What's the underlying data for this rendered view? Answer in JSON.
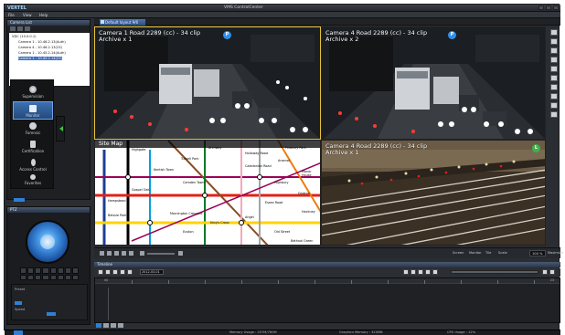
{
  "app": {
    "brand": "VERTEL",
    "title": "VMS ControlCenter"
  },
  "menu": [
    "File",
    "View",
    "Help"
  ],
  "left": {
    "tree_header": "Camera List",
    "tree": [
      "VDC (10.0.0.1)",
      "Camera 1 - 10.46.2.13(Auth)",
      "Camera 4 - 10.46.2.13(23)",
      "Camera 1 - 10.45.2.14(Auth)",
      "Camera 1 - 10.45.2.14(23)"
    ]
  },
  "nav": [
    {
      "label": "Supervision",
      "icon": "globe-icon"
    },
    {
      "label": "Monitor",
      "icon": "camera-icon",
      "active": true
    },
    {
      "label": "Forensic",
      "icon": "magnifier-icon"
    },
    {
      "label": "Certification",
      "icon": "document-icon"
    },
    {
      "label": "Access Control",
      "icon": "person-walking-icon"
    },
    {
      "label": "Favorites",
      "icon": "star-icon"
    }
  ],
  "ptz": {
    "header": "PTZ",
    "presets_label": "Preset",
    "speed_label": "Speed"
  },
  "main": {
    "tab": "Default layout 9/6",
    "tiles": [
      {
        "name": "Camera 1 Road 2289 (cc) - 34 clip",
        "sub": "Archive x 1",
        "badge": "P",
        "badge_color": "#2f8fe8",
        "selected": true
      },
      {
        "name": "Camera 4 Road 2289 (cc) - 34 clip",
        "sub": "Archive x 2",
        "badge": "P",
        "badge_color": "#2f8fe8",
        "selected": false
      },
      {
        "name": "Site Map",
        "sub": "",
        "badge": "",
        "badge_color": "",
        "selected": false
      },
      {
        "name": "Camera 4 Road 2289 (cc) - 34 clip",
        "sub": "Archive x 1",
        "badge": "L",
        "badge_color": "#3bb54a",
        "selected": false
      }
    ],
    "map_labels": [
      "Highgate",
      "Archway",
      "Tufnell Park",
      "Kentish Town",
      "Camden Town",
      "Caledonian Road",
      "Holloway Road",
      "Arsenal",
      "Finsbury Park",
      "Highbury",
      "Essex Road",
      "Angel",
      "Old Street",
      "Euston",
      "King's Cross",
      "Mornington Crescent",
      "Gospel Oak",
      "Hampstead",
      "Belsize Park",
      "Manor House",
      "Dalston",
      "Hackney",
      "Bethnal Green"
    ]
  },
  "status_row": {
    "screen_label": "Screen",
    "monitor_label": "Monitor",
    "tile_label": "Tile",
    "scale_label": "Scale",
    "zoom_value": "100 %",
    "maximize_label": "Maximize"
  },
  "timeline": {
    "header": "Timeline",
    "date_value": "2012-03-01",
    "start_label": "00",
    "end_label": "23"
  },
  "bottom": {
    "memory": "Memory Usage : 257M/780M",
    "graphics": "Graphics Memory : 320MB",
    "cpu": "CPU Usage : 12%"
  }
}
